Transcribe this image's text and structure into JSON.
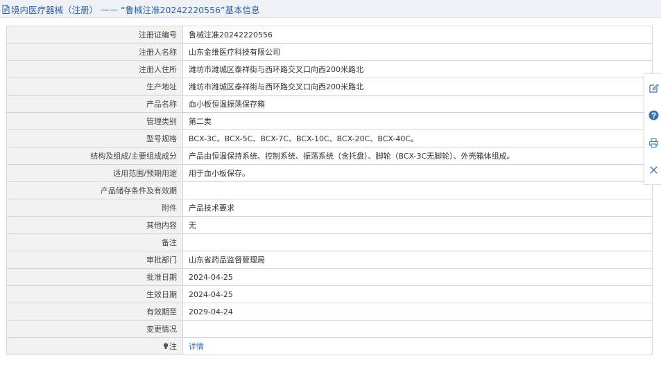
{
  "header": {
    "category": "境内医疗器械（注册）",
    "separator": "——",
    "record_title": "“鲁械注准20242220556”基本信息"
  },
  "rows": [
    {
      "label": "注册证编号",
      "value": "鲁械注准20242220556"
    },
    {
      "label": "注册人名称",
      "value": "山东金维医疗科技有限公司"
    },
    {
      "label": "注册人住所",
      "value": "潍坊市潍城区泰祥街与西环路交叉口向西200米路北"
    },
    {
      "label": "生产地址",
      "value": "潍坊市潍城区泰祥街与西环路交叉口向西200米路北"
    },
    {
      "label": "产品名称",
      "value": "血小板恒温振荡保存箱"
    },
    {
      "label": "管理类别",
      "value": "第二类"
    },
    {
      "label": "型号规格",
      "value": "BCX-3C、BCX-5C、BCX-7C、BCX-10C、BCX-20C、BCX-40C。"
    },
    {
      "label": "结构及组成/主要组成成分",
      "value": "产品由恒温保持系统、控制系统、振荡系统（含托盘）、脚轮（BCX-3C无脚轮）、外壳箱体组成。"
    },
    {
      "label": "适用范围/预期用途",
      "value": "用于血小板保存。"
    },
    {
      "label": "产品储存条件及有效期",
      "value": ""
    },
    {
      "label": "附件",
      "value": "产品技术要求"
    },
    {
      "label": "其他内容",
      "value": "无"
    },
    {
      "label": "备注",
      "value": ""
    },
    {
      "label": "审批部门",
      "value": "山东省药品监督管理局"
    },
    {
      "label": "批准日期",
      "value": "2024-04-25"
    },
    {
      "label": "生效日期",
      "value": "2024-04-25"
    },
    {
      "label": "有效期至",
      "value": "2029-04-24"
    },
    {
      "label": "变更情况",
      "value": ""
    }
  ],
  "note_row": {
    "label": "注",
    "link": "详情"
  },
  "colors": {
    "header_bg": "#eef1f5",
    "header_text": "#2f5fa0",
    "label_bg": "#f2f2f2",
    "border": "#d5d5d5",
    "link": "#2a6fb8",
    "toolbar_icon": "#3b73b9"
  },
  "icons": {
    "header": "document-icon",
    "note": "lightbulb-icon",
    "toolbar": [
      "edit-icon",
      "help-icon",
      "print-icon",
      "close-icon"
    ]
  }
}
